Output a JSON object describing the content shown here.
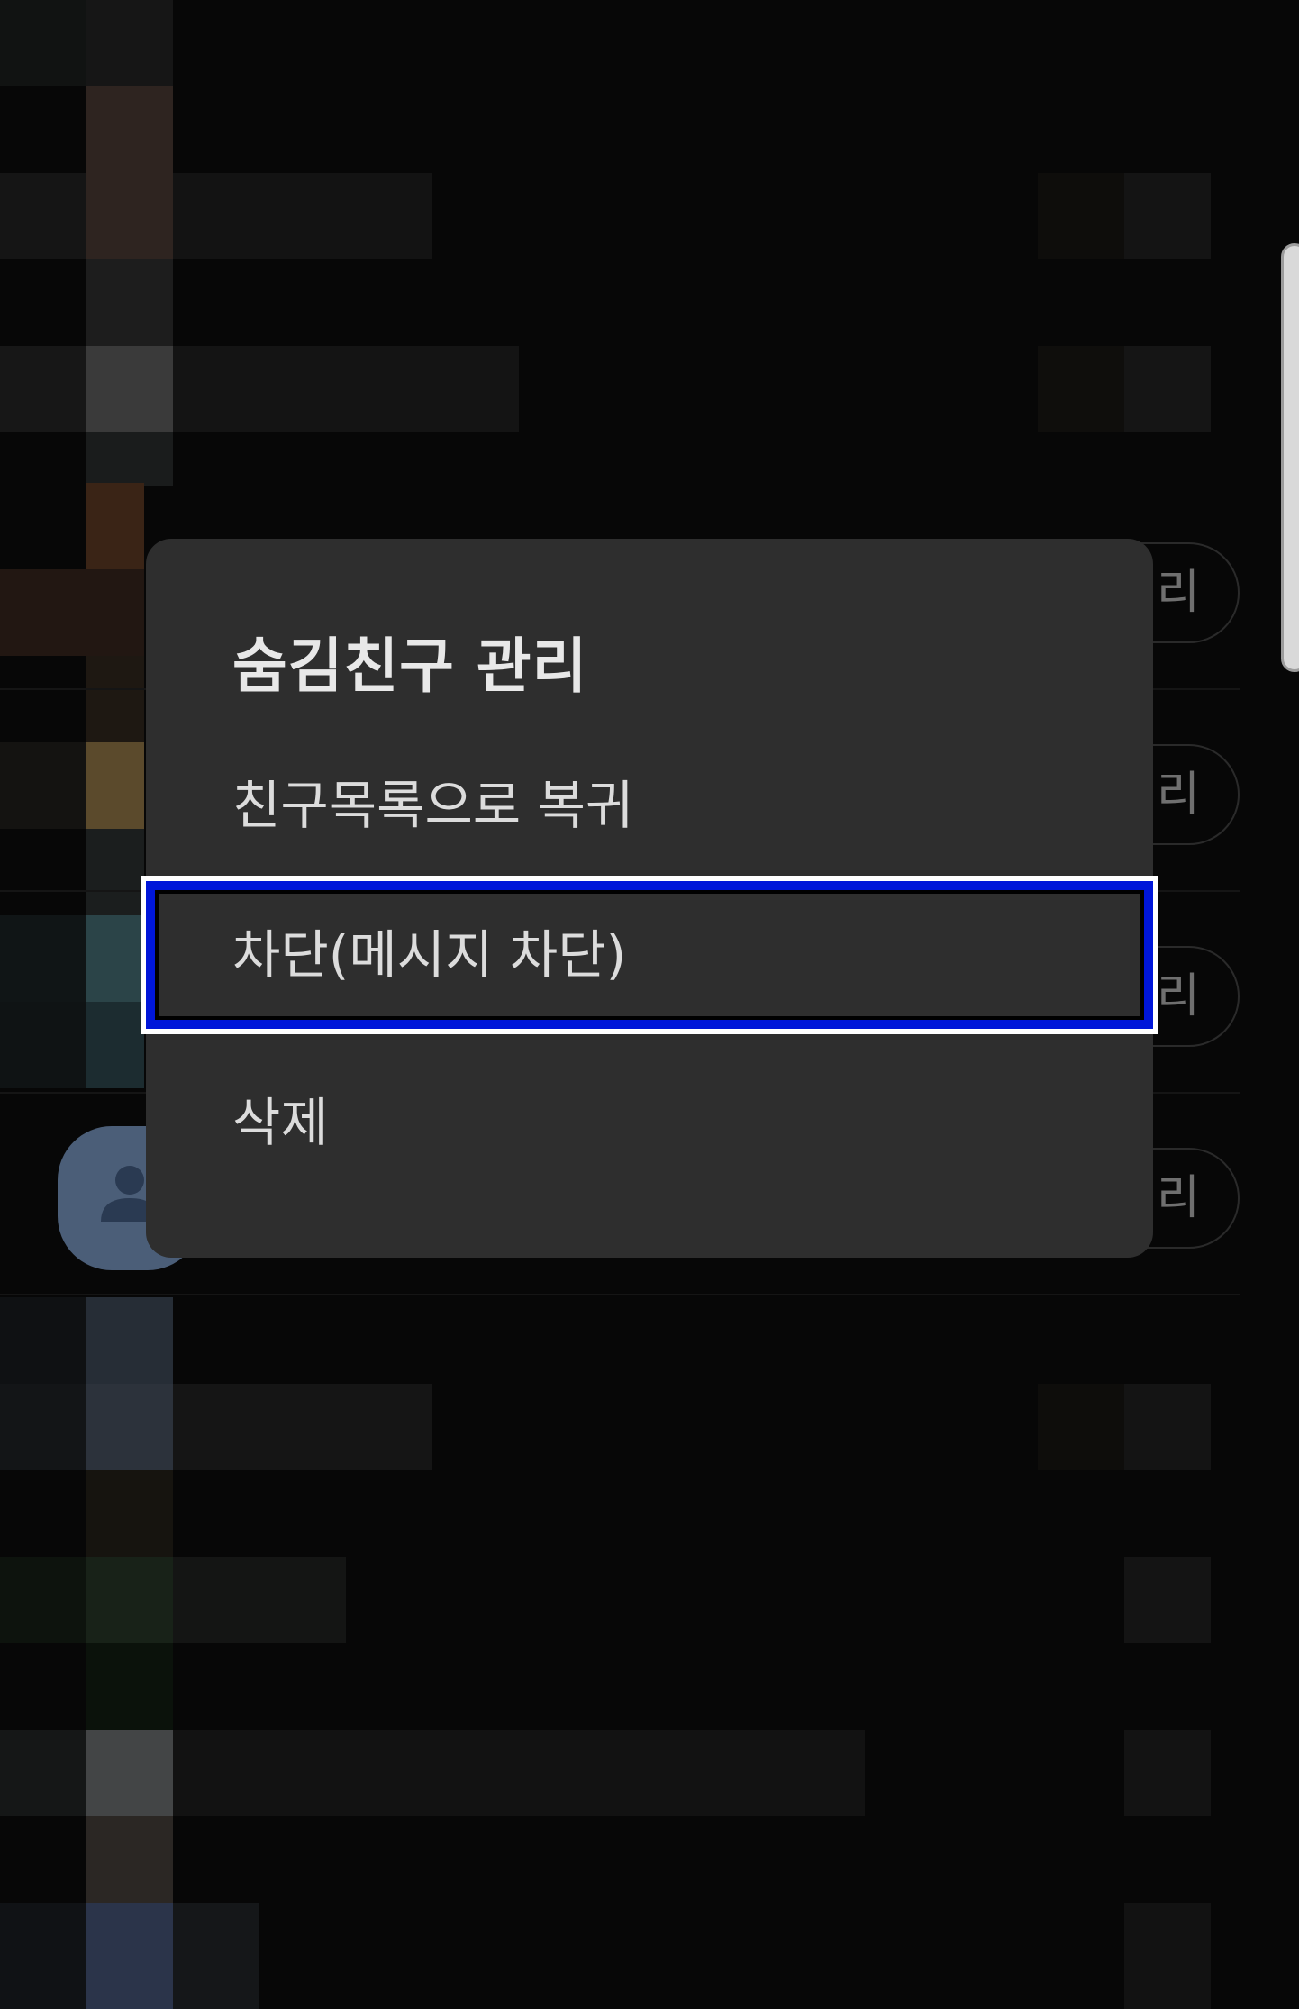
{
  "dialog": {
    "title": "숨김친구 관리",
    "options": [
      {
        "label": "친구목록으로 복귀",
        "focused": false
      },
      {
        "label": "차단(메시지 차단)",
        "focused": true
      },
      {
        "label": "삭제",
        "focused": false
      }
    ]
  },
  "background_list": {
    "manage_label_fragment": "리",
    "rows": 4
  },
  "colors": {
    "dialog_bg": "#2e2e2e",
    "screen_bg": "#070707",
    "focus_ring": "#0016d9",
    "text": "#dcdcdc"
  }
}
